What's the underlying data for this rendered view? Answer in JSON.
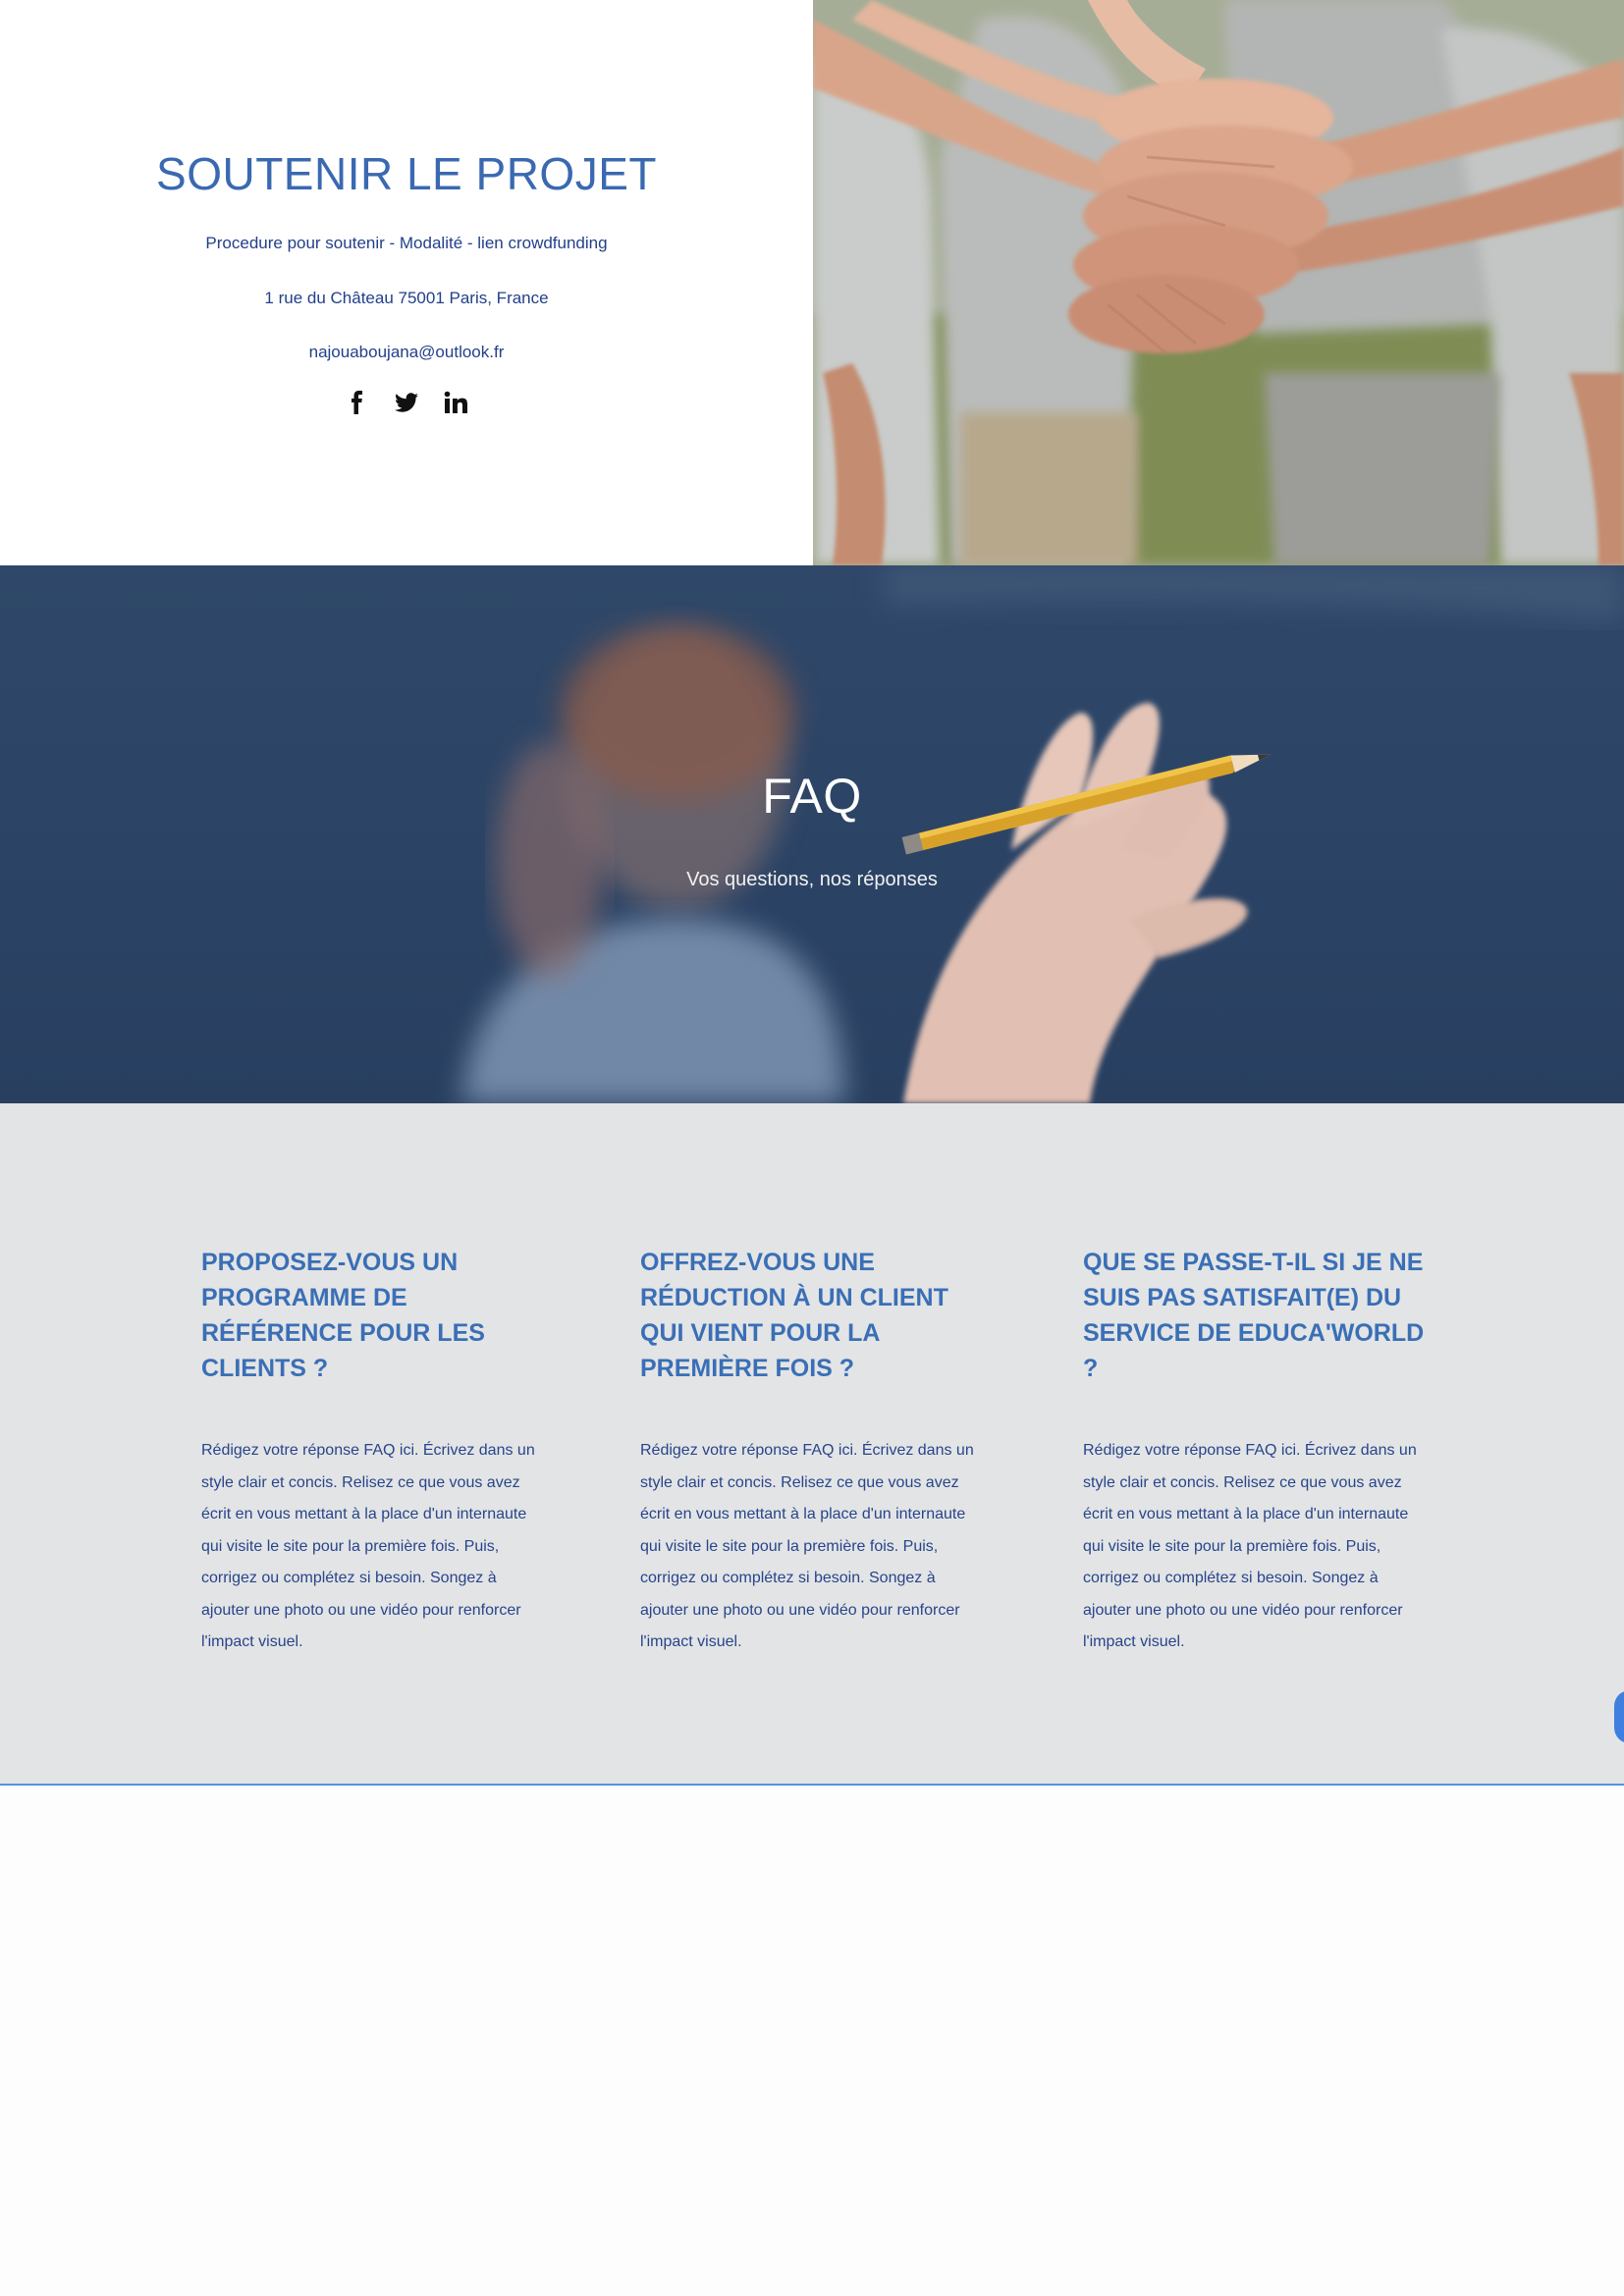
{
  "support": {
    "title": "SOUTENIR LE PROJET",
    "procedure": "Procedure pour soutenir - Modalité - lien crowdfunding",
    "address": "1 rue du Château 75001 Paris, France",
    "email": "najouaboujana@outlook.fr",
    "socials": [
      {
        "icon": "facebook-icon"
      },
      {
        "icon": "twitter-icon"
      },
      {
        "icon": "linkedin-icon"
      }
    ],
    "image": "hands-stacked-teamwork-photo"
  },
  "faq_banner": {
    "title": "FAQ",
    "subtitle": "Vos questions, nos réponses",
    "image": "student-raising-hand-with-pencil-photo"
  },
  "faq": [
    {
      "question": "PROPOSEZ-VOUS UN PROGRAMME DE RÉFÉRENCE POUR LES CLIENTS ?",
      "answer": "Rédigez votre réponse FAQ ici. Écrivez dans un style clair et concis. Relisez ce que vous avez écrit en vous mettant à la place d'un internaute qui visite le site pour la première fois. Puis, corrigez ou complétez si besoin. Songez à ajouter une photo ou une vidéo pour renforcer l'impact visuel."
    },
    {
      "question": "OFFREZ-VOUS UNE RÉDUCTION À UN CLIENT QUI VIENT POUR LA PREMIÈRE FOIS ?",
      "answer": "Rédigez votre réponse FAQ ici. Écrivez dans un style clair et concis. Relisez ce que vous avez écrit en vous mettant à la place d'un internaute qui visite le site pour la première fois. Puis, corrigez ou complétez si besoin. Songez à ajouter une photo ou une vidéo pour renforcer l'impact visuel."
    },
    {
      "question": "QUE SE PASSE-T-IL SI JE NE SUIS PAS SATISFAIT(E) DU SERVICE DE EDUCA'WORLD ?",
      "answer": "Rédigez votre réponse FAQ ici. Écrivez dans un style clair et concis. Relisez ce que vous avez écrit en vous mettant à la place d'un internaute qui visite le site pour la première fois. Puis, corrigez ou complétez si besoin. Songez à ajouter une photo ou une vidéo pour renforcer l'impact visuel."
    }
  ],
  "colors": {
    "accent_blue": "#3a69b1",
    "text_navy": "#23408a",
    "banner_navy": "#2b4365",
    "faq_background": "#e3e4e5",
    "divider_blue": "#5b8fdc"
  }
}
